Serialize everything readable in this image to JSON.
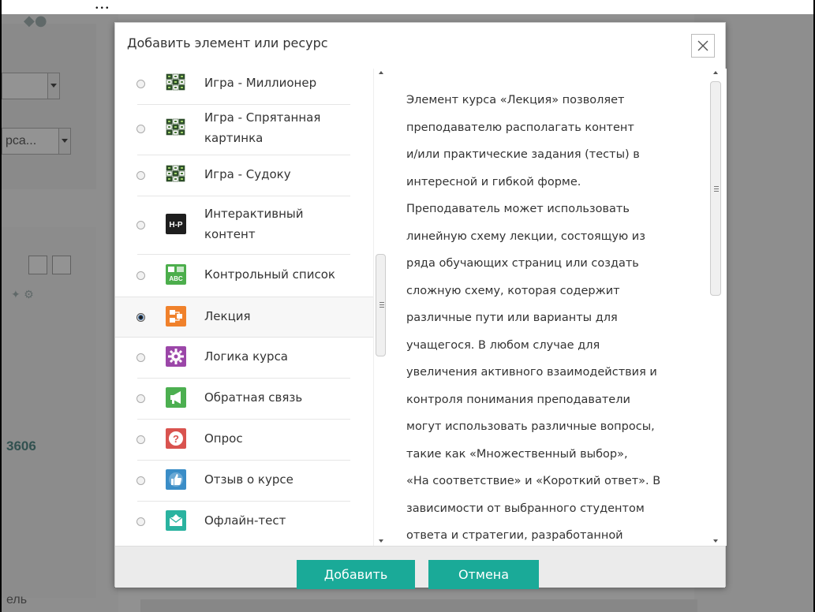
{
  "page": {
    "top_text": "...",
    "bg_select_partial": "рса...",
    "bg_number": "3606",
    "bg_word": "ель"
  },
  "dialog": {
    "title": "Добавить элемент или ресурс",
    "close_icon": "close-icon",
    "options": [
      {
        "label_lines": [
          "Игра - Миллионер"
        ],
        "icon": "game-grid-icon",
        "selected": false
      },
      {
        "label_lines": [
          "Игра - Спрятанная",
          "картинка"
        ],
        "icon": "game-grid-icon",
        "selected": false
      },
      {
        "label_lines": [
          "Игра - Судоку"
        ],
        "icon": "game-grid-icon",
        "selected": false
      },
      {
        "label_lines": [
          "Интерактивный",
          "контент"
        ],
        "icon": "h5p-icon",
        "selected": false
      },
      {
        "label_lines": [
          "Контрольный список"
        ],
        "icon": "checklist-abc-icon",
        "selected": false
      },
      {
        "label_lines": [
          "Лекция"
        ],
        "icon": "lesson-icon",
        "selected": true
      },
      {
        "label_lines": [
          "Логика курса"
        ],
        "icon": "gear-icon",
        "selected": false
      },
      {
        "label_lines": [
          "Обратная связь"
        ],
        "icon": "megaphone-icon",
        "selected": false
      },
      {
        "label_lines": [
          "Опрос"
        ],
        "icon": "question-icon",
        "selected": false
      },
      {
        "label_lines": [
          "Отзыв о курсе"
        ],
        "icon": "thumbs-up-icon",
        "selected": false
      },
      {
        "label_lines": [
          "Офлайн-тест"
        ],
        "icon": "envelope-icon",
        "selected": false
      }
    ],
    "description_lines": [
      "Элемент курса «Лекция» позволяет",
      "преподавателю располагать контент",
      "и/или практические задания (тесты) в",
      "интересной и гибкой форме.",
      "Преподаватель может использовать",
      "линейную схему лекции, состоящую из",
      "ряда обучающих страниц или создать",
      "сложную схему, которая содержит",
      "различные пути или варианты для",
      "учащегося. В любом случае для",
      "увеличения активного взаимодействия и",
      "контроля понимания преподаватели",
      "могут использовать различные вопросы,",
      "такие как «Множественный выбор»,",
      "«На соответствие» и «Короткий ответ». В",
      "зависимости от выбранного студентом",
      "ответа и стратегии, разработанной"
    ],
    "add_button": "Добавить",
    "cancel_button": "Отмена"
  },
  "colors": {
    "accent_button": "#1aaa98",
    "game_icon_bg": "#2d4e2a",
    "h5p_icon_bg": "#1e1e1e",
    "checklist_icon_bg": "#4cae4c",
    "lesson_icon_bg": "#f0812b",
    "gear_icon_bg": "#9b46a8",
    "megaphone_icon_bg": "#4caf50",
    "question_icon_bg": "#d9534f",
    "thumbs_icon_bg": "#3a8dc7",
    "envelope_icon_bg": "#2ab3a0"
  }
}
